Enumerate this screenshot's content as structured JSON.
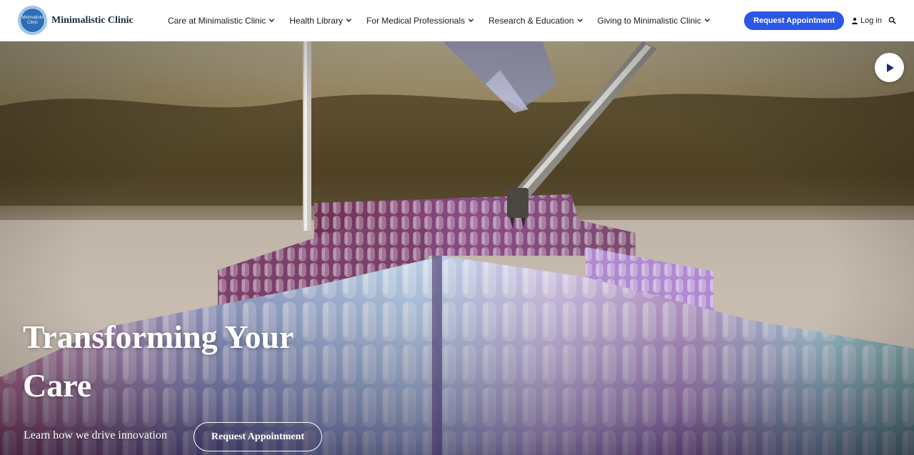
{
  "brand": {
    "logo_text": "Minimalistic Clinic",
    "badge_text": "Minimalistic Clinic"
  },
  "nav": {
    "items": [
      {
        "label": "Care at Minimalistic Clinic"
      },
      {
        "label": "Health Library"
      },
      {
        "label": "For Medical Professionals"
      },
      {
        "label": "Research & Education"
      },
      {
        "label": "Giving to Minimalistic Clinic"
      }
    ]
  },
  "header": {
    "request_label": "Request Appointment",
    "login_label": "Log in"
  },
  "hero": {
    "title": "Transforming Your Care",
    "subtitle": "Learn how we drive innovation",
    "cta_label": "Request Appointment"
  },
  "icons": {
    "chevron": "chevron-down-icon",
    "user": "user-icon",
    "search": "search-icon",
    "play": "play-icon"
  },
  "colors": {
    "accent": "#2a57e6",
    "play_icon": "#1e2a78"
  }
}
